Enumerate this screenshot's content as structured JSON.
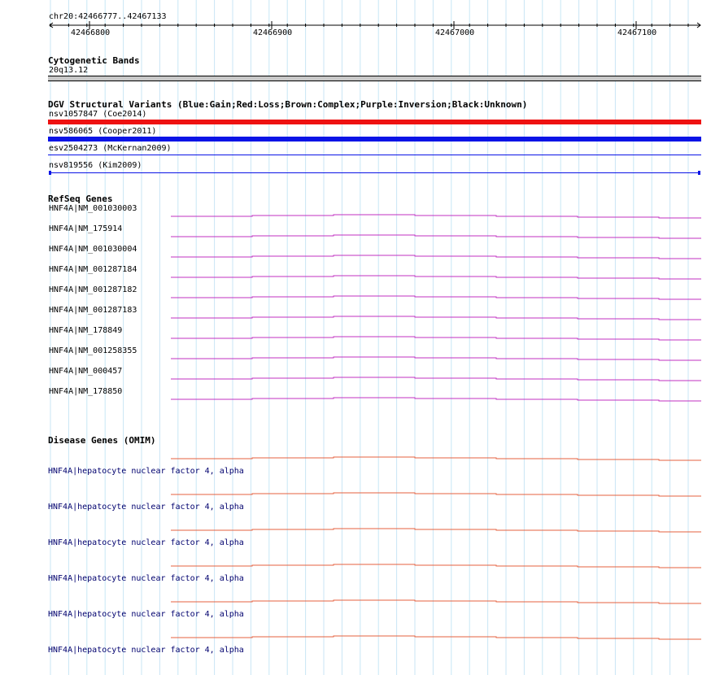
{
  "ruler": {
    "location": "chr20:42466777..42467133",
    "ticks": [
      "42466800",
      "42466900",
      "42467000",
      "42467100"
    ]
  },
  "cytoband": {
    "title": "Cytogenetic Bands",
    "band": "20q13.12"
  },
  "dgv": {
    "title": "DGV Structural Variants (Blue:Gain;Red:Loss;Brown:Complex;Purple:Inversion;Black:Unknown)",
    "variants": [
      {
        "label": "nsv1057847 (Coe2014)",
        "type": "Loss",
        "color": "#ee1111"
      },
      {
        "label": "nsv586065 (Cooper2011)",
        "type": "Gain",
        "color": "#0b14e6"
      },
      {
        "label": "esv2504273 (McKernan2009)",
        "type": "Gain",
        "color": "#0b14e6"
      },
      {
        "label": "nsv819556 (Kim2009)",
        "type": "Gain",
        "color": "#0b14e6"
      }
    ]
  },
  "refseq": {
    "title": "RefSeq Genes",
    "color": "#c030c0",
    "genes": [
      "HNF4A|NM_001030003",
      "HNF4A|NM_175914",
      "HNF4A|NM_001030004",
      "HNF4A|NM_001287184",
      "HNF4A|NM_001287182",
      "HNF4A|NM_001287183",
      "HNF4A|NM_178849",
      "HNF4A|NM_001258355",
      "HNF4A|NM_000457",
      "HNF4A|NM_178850"
    ]
  },
  "omim": {
    "title": "Disease Genes (OMIM)",
    "color": "#e5603f",
    "genes": [
      "HNF4A|hepatocyte nuclear factor 4, alpha",
      "HNF4A|hepatocyte nuclear factor 4, alpha",
      "HNF4A|hepatocyte nuclear factor 4, alpha",
      "HNF4A|hepatocyte nuclear factor 4, alpha",
      "HNF4A|hepatocyte nuclear factor 4, alpha",
      "HNF4A|hepatocyte nuclear factor 4, alpha"
    ]
  },
  "colors": {
    "grid_line": "#c8e6f5"
  }
}
